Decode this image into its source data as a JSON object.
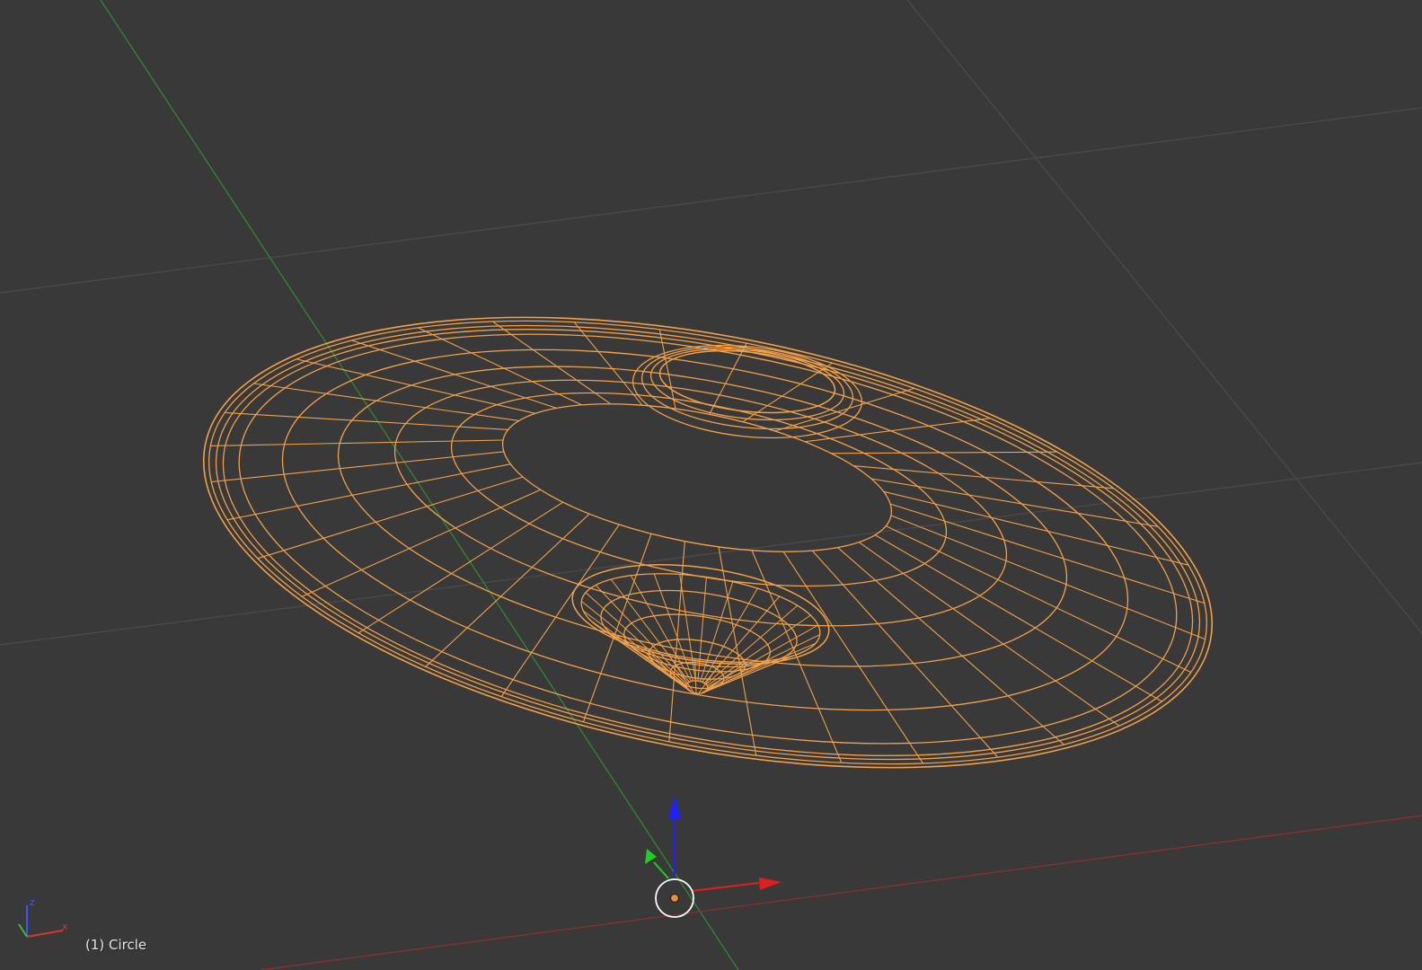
{
  "viewport": {
    "object_label": "(1) Circle"
  },
  "axis_gizmo": {
    "z_label": "z",
    "x_label": "x"
  },
  "colors": {
    "background": "#393939",
    "grid_line": "#4b4b4b",
    "x_axis": "#8f2f2f",
    "y_axis": "#2f8f2f",
    "selection_wire": "#f2a14a",
    "manipulator_z": "#2020ff",
    "manipulator_x": "#e02020",
    "manipulator_y": "#20d020",
    "origin_point": "#e8913a"
  },
  "icons": {
    "manipulator": "translate-manipulator-icon",
    "orientation": "axis-orientation-icon"
  }
}
